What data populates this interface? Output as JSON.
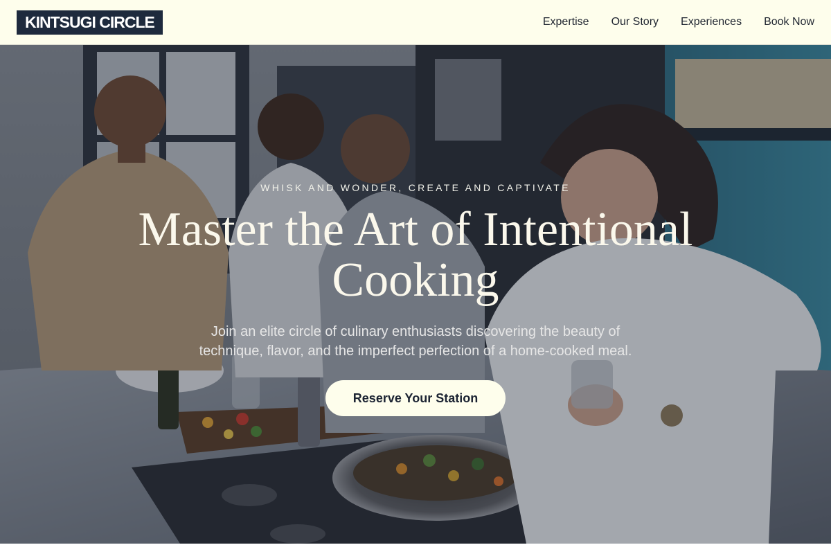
{
  "header": {
    "logo": "KINTSUGI CIRCLE",
    "nav": [
      {
        "label": "Expertise"
      },
      {
        "label": "Our Story"
      },
      {
        "label": "Experiences"
      },
      {
        "label": "Book Now"
      }
    ]
  },
  "hero": {
    "eyebrow": "WHISK AND WONDER, CREATE AND CAPTIVATE",
    "headline_line1": "Master the Art of Intentional",
    "headline_line2": "Cooking",
    "subtext": "Join an elite circle of culinary enthusiasts discovering the beauty of technique, flavor, and the imperfect perfection of a home-cooked meal.",
    "cta_label": "Reserve Your Station",
    "image_subject": "group-cooking-kitchen-photo"
  },
  "colors": {
    "header_bg": "#fefeec",
    "logo_bg": "#1e2a3d",
    "cta_bg": "#fefeec",
    "cta_text": "#1b2332",
    "overlay": "#181e2c"
  }
}
